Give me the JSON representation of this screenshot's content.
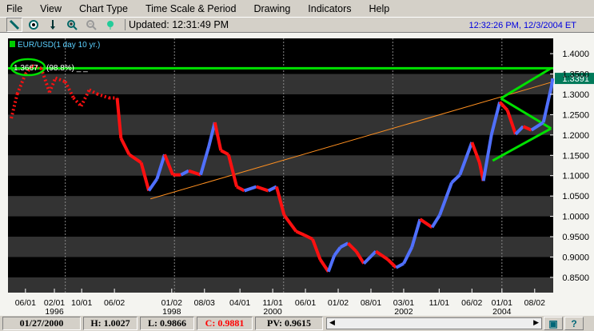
{
  "menu": [
    "File",
    "View",
    "Chart Type",
    "Time Scale & Period",
    "Drawing",
    "Indicators",
    "Help"
  ],
  "toolbar": {
    "updated": "Updated: 12:31:49 PM",
    "clock": "12:32:26 PM, 12/3/2004 ET"
  },
  "chart_data": {
    "type": "line",
    "title": "EUR/USD(1 day  10 yr.)",
    "ylim": [
      0.8125,
      1.4375
    ],
    "xlim": [
      1994.95,
      2004.94
    ],
    "yticks": [
      "1.4000",
      "1.3500",
      "1.3000",
      "1.2500",
      "1.2000",
      "1.1500",
      "1.1000",
      "1.0500",
      "1.0000",
      "0.9500",
      "0.9000",
      "0.8500"
    ],
    "xticks": [
      {
        "t": "06/01",
        "sub": "",
        "x": 1995.27
      },
      {
        "t": "02/01",
        "sub": "1996",
        "x": 1995.8
      },
      {
        "t": "10/01",
        "sub": "",
        "x": 1996.3
      },
      {
        "t": "06/02",
        "sub": "",
        "x": 1996.9
      },
      {
        "t": "01/02",
        "sub": "1998",
        "x": 1997.95
      },
      {
        "t": "08/03",
        "sub": "",
        "x": 1998.55
      },
      {
        "t": "04/01",
        "sub": "",
        "x": 1999.2
      },
      {
        "t": "11/01",
        "sub": "2000",
        "x": 1999.8
      },
      {
        "t": "06/01",
        "sub": "",
        "x": 2000.4
      },
      {
        "t": "01/02",
        "sub": "",
        "x": 2001.0
      },
      {
        "t": "08/01",
        "sub": "",
        "x": 2001.6
      },
      {
        "t": "03/01",
        "sub": "2002",
        "x": 2002.2
      },
      {
        "t": "11/01",
        "sub": "",
        "x": 2002.85
      },
      {
        "t": "06/02",
        "sub": "",
        "x": 2003.45
      },
      {
        "t": "01/01",
        "sub": "2004",
        "x": 2004.0
      },
      {
        "t": "08/02",
        "sub": "",
        "x": 2004.6
      }
    ],
    "series": [
      {
        "name": "EUR/USD",
        "x": [
          1995.01,
          1995.12,
          1995.27,
          1995.39,
          1995.56,
          1995.71,
          1995.82,
          1996.0,
          1996.15,
          1996.29,
          1996.44,
          1996.58,
          1996.8,
          1996.95,
          1997.02,
          1997.17,
          1997.39,
          1997.53,
          1997.68,
          1997.82,
          1997.97,
          1998.12,
          1998.26,
          1998.48,
          1998.63,
          1998.74,
          1998.85,
          1998.99,
          1999.14,
          1999.28,
          1999.5,
          1999.72,
          1999.87,
          2000.01,
          2000.23,
          2000.38,
          2000.53,
          2000.67,
          2000.82,
          2000.93,
          2001.04,
          2001.18,
          2001.33,
          2001.47,
          2001.69,
          2001.91,
          2002.06,
          2002.2,
          2002.35,
          2002.5,
          2002.72,
          2002.86,
          2003.08,
          2003.23,
          2003.45,
          2003.59,
          2003.66,
          2003.81,
          2003.96,
          2004.1,
          2004.25,
          2004.39,
          2004.54,
          2004.76,
          2004.91,
          2004.93
        ],
        "y": [
          1.241,
          1.301,
          1.35,
          1.37,
          1.364,
          1.305,
          1.34,
          1.331,
          1.291,
          1.271,
          1.311,
          1.301,
          1.291,
          1.291,
          1.192,
          1.152,
          1.132,
          1.063,
          1.092,
          1.152,
          1.102,
          1.102,
          1.112,
          1.102,
          1.172,
          1.231,
          1.162,
          1.152,
          1.073,
          1.063,
          1.073,
          1.063,
          1.073,
          1.003,
          0.963,
          0.954,
          0.944,
          0.894,
          0.864,
          0.904,
          0.924,
          0.934,
          0.914,
          0.884,
          0.914,
          0.894,
          0.874,
          0.884,
          0.924,
          0.993,
          0.973,
          1.003,
          1.083,
          1.102,
          1.182,
          1.132,
          1.087,
          1.202,
          1.281,
          1.261,
          1.202,
          1.221,
          1.212,
          1.231,
          1.321,
          1.3391
        ]
      }
    ],
    "last_price": "1.3391",
    "annotation": {
      "text": "1.3667",
      "pct": "(98.8%)",
      "value": 1.3667
    },
    "lines": [
      {
        "name": "resistance",
        "color": "#00e000",
        "x": [
          1994.95,
          2004.94
        ],
        "y": [
          1.364,
          1.364
        ]
      },
      {
        "name": "trend",
        "color": "#ff9020",
        "x": [
          1997.56,
          2004.94
        ],
        "y": [
          1.043,
          1.331
        ]
      },
      {
        "name": "tri-upper",
        "color": "#00e000",
        "x": [
          2003.98,
          2004.9
        ],
        "y": [
          1.29,
          1.364
        ]
      },
      {
        "name": "tri-mid",
        "color": "#00e000",
        "x": [
          2003.98,
          2004.9
        ],
        "y": [
          1.29,
          1.216
        ]
      },
      {
        "name": "tri-lower",
        "color": "#00e000",
        "x": [
          2003.83,
          2004.9
        ],
        "y": [
          1.137,
          1.216
        ]
      }
    ]
  },
  "status": {
    "date": "01/27/2000",
    "high": "H: 1.0027",
    "low": "L: 0.9866",
    "close": "C: 0.9881",
    "pv": "PV: 0.9615"
  }
}
